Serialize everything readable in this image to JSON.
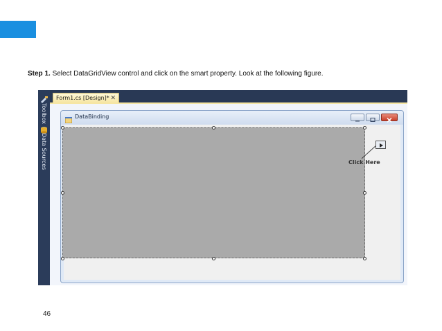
{
  "slide": {
    "step_label": "Step 1.",
    "step_text": " Select DataGridView control and click on the smart property. Look at the following figure.",
    "page_number": "46",
    "accent_color": "#1a8fe0"
  },
  "ide": {
    "side_panels": [
      {
        "label": "Toolbox",
        "icon": "toolbox-icon"
      },
      {
        "label": "Data Sources",
        "icon": "data-sources-icon"
      }
    ],
    "document_tab": {
      "label": "Form1.cs [Design]*",
      "close_glyph": "✕"
    }
  },
  "form": {
    "title": "DataBinding",
    "icon": "form-icon",
    "controls": {
      "minimize": "minimize-icon",
      "maximize": "maximize-icon",
      "close": "close-icon"
    }
  },
  "datagridview": {
    "smart_tag_icon": "smart-tag-arrow-icon",
    "callout_text": "Click Here"
  }
}
